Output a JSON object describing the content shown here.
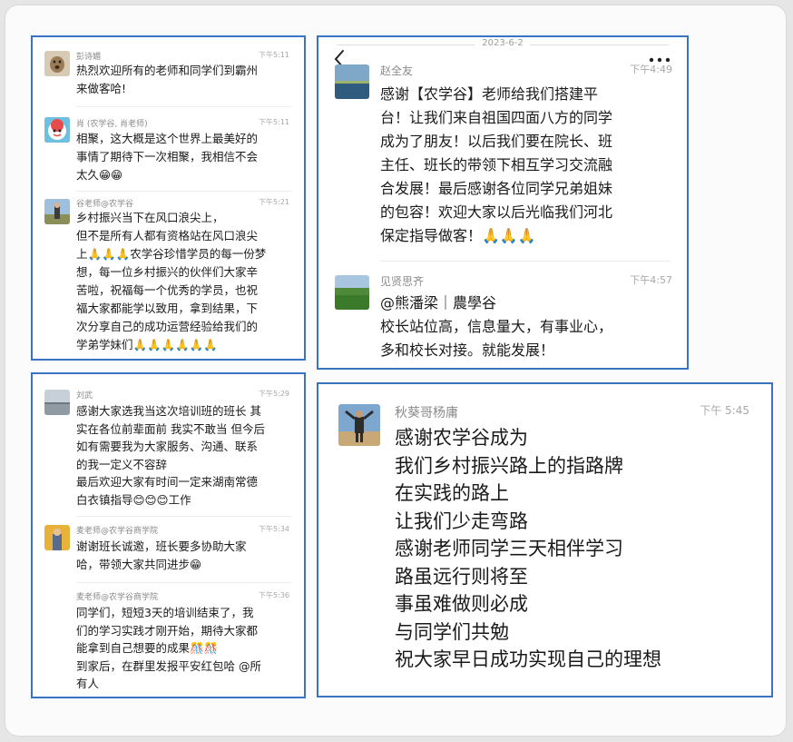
{
  "panel1": {
    "messages": [
      {
        "name": "彭诗媚",
        "time": "下午5:11",
        "text": "热烈欢迎所有的老师和同学们到霸州\n来做客哈!"
      },
      {
        "name": "肖 (农学谷, 肖老师)",
        "time": "下午5:11",
        "text": "相聚，这大概是这个世界上最美好的\n事情了期待下一次相聚，我相信不会\n太久😁😁"
      },
      {
        "name": "谷老师@农学谷",
        "time": "下午5:21",
        "text": "乡村振兴当下在风口浪尖上，\n但不是所有人都有资格站在风口浪尖\n上🙏🙏🙏农学谷珍惜学员的每一份梦\n想，每一位乡村振兴的伙伴们大家辛\n苦啦，祝福每一个优秀的学员，也祝\n福大家都能学以致用，拿到结果，下\n次分享自己的成功运营经验给我们的\n学弟学妹们🙏🙏🙏🙏🙏🙏"
      }
    ]
  },
  "panel2": {
    "date": "2023-6-2",
    "messages": [
      {
        "name": "赵全友",
        "time": "下午4:49",
        "text": "感谢【农学谷】老师给我们搭建平\n台！让我们来自祖国四面八方的同学\n成为了朋友！以后我们要在院长、班\n主任、班长的带领下相互学习交流融\n合发展！最后感谢各位同学兄弟姐妹\n的包容！欢迎大家以后光临我们河北\n保定指导做客！🙏🙏🙏"
      },
      {
        "name": "见贤思齐",
        "time": "下午4:57",
        "text": "@熊潘梁｜農學谷\n校长站位高，信息量大，有事业心，\n多和校长对接。就能发展！"
      }
    ]
  },
  "panel3": {
    "messages": [
      {
        "name": "刘武",
        "time": "下午5:29",
        "text": "感谢大家选我当这次培训班的班长 其\n实在各位前辈面前 我实不敢当 但今后\n如有需要我为大家服务、沟通、联系\n的我一定义不容辞\n最后欢迎大家有时间一定来湖南常德\n白衣镇指导😊😊😊工作"
      },
      {
        "name": "麦老师@农学谷商学院",
        "time": "下午5:34",
        "text": "谢谢班长诚邀，班长要多协助大家\n哈，带领大家共同进步😁"
      },
      {
        "name": "麦老师@农学谷商学院",
        "time": "下午5:36",
        "text": "同学们，短短3天的培训结束了，我\n们的学习实践才刚开始，期待大家都\n能拿到自己想要的成果🎊🎊\n到家后，在群里发报平安红包哈 @所\n有人"
      }
    ]
  },
  "panel4": {
    "messages": [
      {
        "name": "秋葵哥杨庸",
        "time": "下午 5:45",
        "text": "感谢农学谷成为\n我们乡村振兴路上的指路牌\n在实践的路上\n让我们少走弯路\n感谢老师同学三天相伴学习\n路虽远行则将至\n事虽难做则必成\n与同学们共勉\n祝大家早日成功实现自己的理想"
      }
    ]
  }
}
